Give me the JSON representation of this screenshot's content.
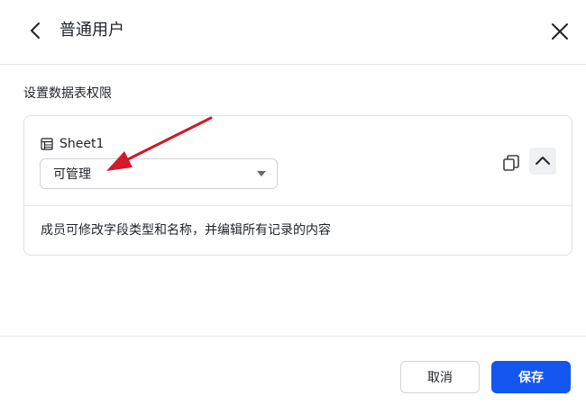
{
  "dialog": {
    "title": "普通用户",
    "back_icon": "chevron-left-icon",
    "close_icon": "close-icon"
  },
  "permissions": {
    "section_label": "设置数据表权限",
    "sheet": {
      "icon": "table-icon",
      "name": "Sheet1",
      "permission_value": "可管理",
      "description": "成员可修改字段类型和名称，并编辑所有记录的内容",
      "copy_icon": "copy-icon",
      "collapse_icon": "chevron-up-icon"
    }
  },
  "footer": {
    "cancel_label": "取消",
    "save_label": "保存"
  },
  "colors": {
    "primary": "#1456f0",
    "border": "#dee0e3",
    "annotation_arrow": "#d0192b"
  }
}
